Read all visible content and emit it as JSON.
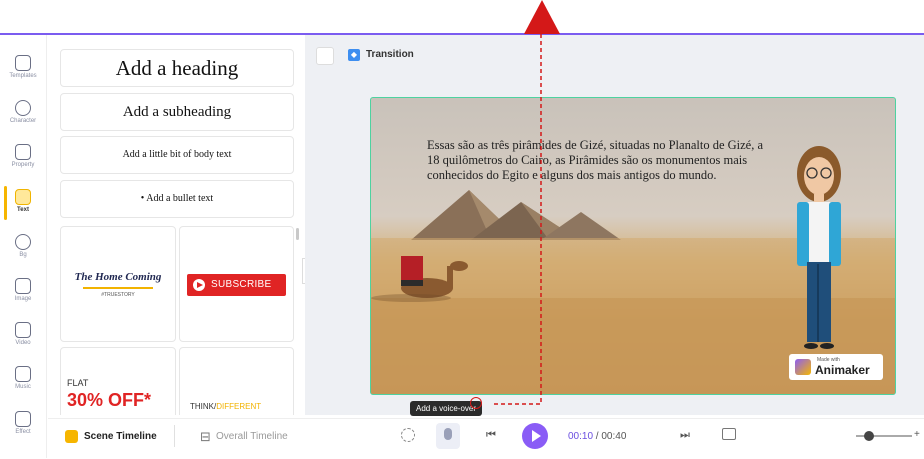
{
  "sidebar": {
    "items": [
      {
        "label": "Templates",
        "icon": "templates-icon"
      },
      {
        "label": "Character",
        "icon": "character-icon"
      },
      {
        "label": "Property",
        "icon": "property-icon"
      },
      {
        "label": "Text",
        "icon": "text-icon",
        "active": true
      },
      {
        "label": "Bg",
        "icon": "background-icon"
      },
      {
        "label": "Image",
        "icon": "image-icon"
      },
      {
        "label": "Video",
        "icon": "video-icon"
      },
      {
        "label": "Music",
        "icon": "music-icon"
      },
      {
        "label": "Effect",
        "icon": "effect-icon"
      }
    ]
  },
  "text_panel": {
    "heading": "Add a heading",
    "subheading": "Add a subheading",
    "body": "Add a little bit of body text",
    "bullet": "Add a bullet text",
    "cards": {
      "home_title": "The Home Coming",
      "home_tag": "#TRUESTORY",
      "subscribe": "SUBSCRIBE",
      "flat": "FLAT",
      "off": "30% OFF*",
      "think": "THINK/",
      "different": "DIFFERENT"
    }
  },
  "stage": {
    "transition_label": "Transition",
    "scene_text": "Essas são as três pirâmides de Gizé, situadas no Planalto de Gizé, a 18 quilômetros do Cairo, as Pirâmides são os monumentos mais conhecidos do Egito e alguns dos mais antigos do mundo.",
    "brand_made": "Made with",
    "brand_name": "Animaker",
    "tooltip": "Add a voice-over"
  },
  "bottom_bar": {
    "scene_timeline": "Scene Timeline",
    "overall_timeline": "Overall Timeline",
    "current_time": "00:10",
    "separator": " / ",
    "total_time": "00:40"
  },
  "colors": {
    "accent": "#7b5cf0",
    "active_tab": "#f6b500",
    "scene_border": "#4ed2a0",
    "annotation": "#d41818",
    "subscribe": "#e02424"
  }
}
